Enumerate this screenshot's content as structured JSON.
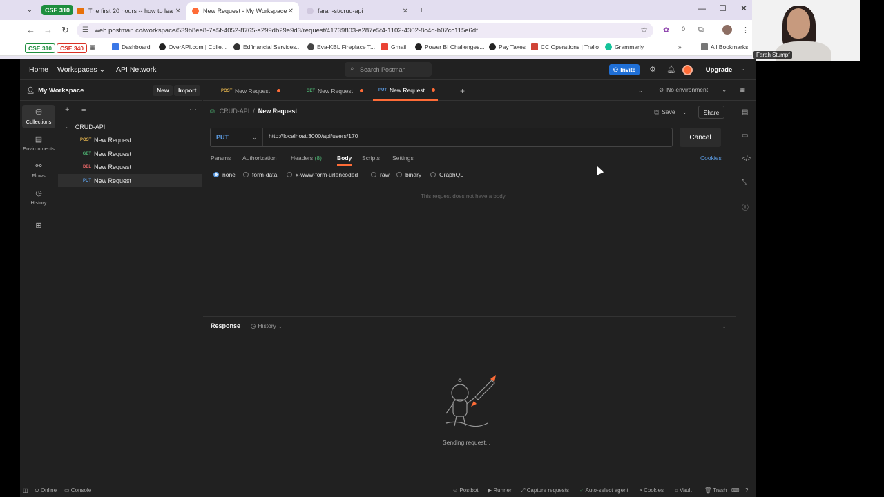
{
  "browser": {
    "tab_groups": [
      {
        "label": "CSE 310",
        "color": "#1e8e3e"
      }
    ],
    "tabs": [
      {
        "title": "The first 20 hours -- how to lea",
        "active": false
      },
      {
        "title": "New Request - My Workspace",
        "active": true
      },
      {
        "title": "farah-st/crud-api",
        "active": false
      }
    ],
    "url": "web.postman.co/workspace/539b8ee8-7a5f-4052-8765-a299db29e9d3/request/41739803-a287e5f4-1102-4302-8c4d-b07cc115e6df",
    "extension_count": "0",
    "bookmarks": [
      {
        "label": "CSE 310",
        "type": "group",
        "color": "#1e8e3e"
      },
      {
        "label": "CSE 340",
        "type": "group",
        "color": "#d93025"
      },
      {
        "label": "Dashboard",
        "icon": "dashboard-icon"
      },
      {
        "label": "OverAPI.com | Colle...",
        "icon": "github-icon"
      },
      {
        "label": "Edfinancial Services...",
        "icon": "edfinancial-icon"
      },
      {
        "label": "Eva-KBL Fireplace T...",
        "icon": "location-icon"
      },
      {
        "label": "Gmail",
        "icon": "gmail-icon"
      },
      {
        "label": "Power BI Challenges...",
        "icon": "github-icon"
      },
      {
        "label": "Pay Taxes",
        "icon": "github-icon"
      },
      {
        "label": "CC Operations | Trello",
        "icon": "trello-icon"
      },
      {
        "label": "Grammarly",
        "icon": "grammarly-icon"
      }
    ],
    "all_bookmarks": "All Bookmarks"
  },
  "webcam": {
    "name": "Farah Stumpf"
  },
  "postman": {
    "nav": {
      "home": "Home",
      "workspaces": "Workspaces",
      "api_network": "API Network"
    },
    "search_placeholder": "Search Postman",
    "invite": "Invite",
    "upgrade": "Upgrade",
    "workspace": {
      "title": "My Workspace",
      "new": "New",
      "import": "Import"
    },
    "rail": [
      {
        "label": "Collections",
        "icon": "collections-icon",
        "active": true
      },
      {
        "label": "Environments",
        "icon": "environments-icon",
        "active": false
      },
      {
        "label": "Flows",
        "icon": "flows-icon",
        "active": false
      },
      {
        "label": "History",
        "icon": "history-icon",
        "active": false
      }
    ],
    "collection": {
      "name": "CRUD-API",
      "items": [
        {
          "method": "POST",
          "name": "New Request"
        },
        {
          "method": "GET",
          "name": "New Request"
        },
        {
          "method": "DEL",
          "name": "New Request"
        },
        {
          "method": "PUT",
          "name": "New Request",
          "selected": true
        }
      ]
    },
    "open_tabs": [
      {
        "method": "POST",
        "name": "New Request",
        "unsaved": true
      },
      {
        "method": "GET",
        "name": "New Request",
        "unsaved": true
      },
      {
        "method": "PUT",
        "name": "New Request",
        "unsaved": true,
        "active": true
      }
    ],
    "environment": "No environment",
    "breadcrumb": {
      "collection": "CRUD-API",
      "separator": "/",
      "request": "New Request"
    },
    "save": "Save",
    "share": "Share",
    "request": {
      "method": "PUT",
      "url": "http://localhost:3000/api/users/170",
      "cancel": "Cancel",
      "tabs": [
        "Params",
        "Authorization",
        "Headers",
        "Body",
        "Scripts",
        "Settings"
      ],
      "headers_count": "(8)",
      "active_tab": "Body",
      "cookies": "Cookies",
      "body_options": [
        "none",
        "form-data",
        "x-www-form-urlencoded",
        "raw",
        "binary",
        "GraphQL"
      ],
      "selected_body_option": "none",
      "empty_body_text": "This request does not have a body"
    },
    "response": {
      "title": "Response",
      "history": "History",
      "status_text": "Sending request..."
    },
    "statusbar": {
      "online": "Online",
      "console": "Console",
      "postbot": "Postbot",
      "runner": "Runner",
      "capture": "Capture requests",
      "auto_select": "Auto-select agent",
      "cookies": "Cookies",
      "vault": "Vault",
      "trash": "Trash"
    }
  }
}
